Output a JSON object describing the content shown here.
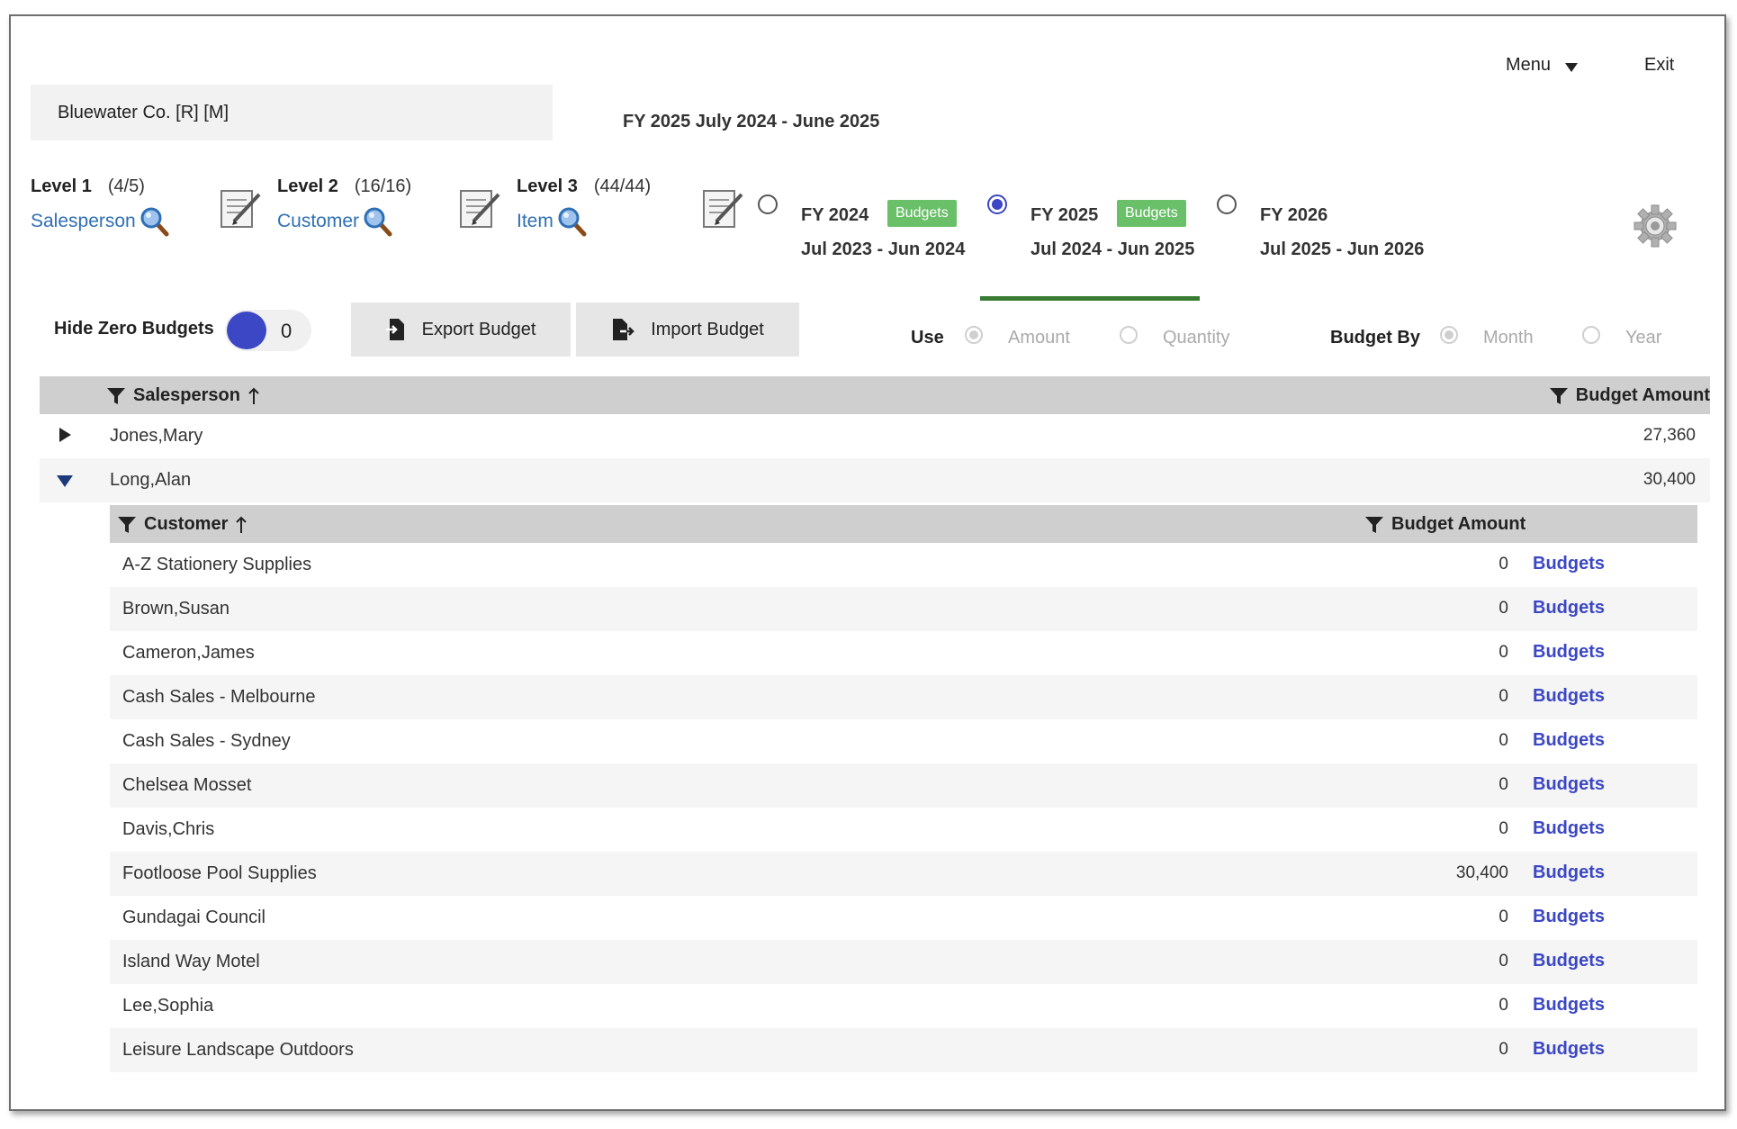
{
  "topnav": {
    "menu_label": "Menu",
    "exit_label": "Exit"
  },
  "company": {
    "name": "Bluewater Co. [R] [M]"
  },
  "fiscal_title": "FY 2025 July 2024 - June 2025",
  "levels": [
    {
      "title": "Level 1",
      "count": "(4/5)",
      "link": "Salesperson"
    },
    {
      "title": "Level 2",
      "count": "(16/16)",
      "link": "Customer"
    },
    {
      "title": "Level 3",
      "count": "(44/44)",
      "link": "Item"
    }
  ],
  "fiscal_years": [
    {
      "name": "FY 2024",
      "range": "Jul 2023 - Jun 2024",
      "badge": "Budgets",
      "selected": false
    },
    {
      "name": "FY 2025",
      "range": "Jul 2024 - Jun 2025",
      "badge": "Budgets",
      "selected": true
    },
    {
      "name": "FY 2026",
      "range": "Jul 2025 - Jun 2026",
      "badge": "",
      "selected": false
    }
  ],
  "controls": {
    "hide_zero_label": "Hide Zero Budgets",
    "hide_zero_value": "0",
    "export_label": "Export Budget",
    "import_label": "Import Budget",
    "use_label": "Use",
    "use_options": [
      "Amount",
      "Quantity"
    ],
    "use_selected": "Amount",
    "budget_by_label": "Budget By",
    "budget_by_options": [
      "Month",
      "Year"
    ],
    "budget_by_selected": "Month"
  },
  "table": {
    "col_salesperson": "Salesperson",
    "col_amount": "Budget Amount",
    "rows": [
      {
        "name": "Jones,Mary",
        "amount": "27,360",
        "expanded": false
      },
      {
        "name": "Long,Alan",
        "amount": "30,400",
        "expanded": true
      }
    ]
  },
  "subtable": {
    "col_customer": "Customer",
    "col_amount": "Budget Amount",
    "link_label": "Budgets",
    "rows": [
      {
        "name": "A-Z Stationery Supplies",
        "amount": "0"
      },
      {
        "name": "Brown,Susan",
        "amount": "0"
      },
      {
        "name": "Cameron,James",
        "amount": "0"
      },
      {
        "name": "Cash Sales - Melbourne",
        "amount": "0"
      },
      {
        "name": "Cash Sales - Sydney",
        "amount": "0"
      },
      {
        "name": "Chelsea Mosset",
        "amount": "0"
      },
      {
        "name": "Davis,Chris",
        "amount": "0"
      },
      {
        "name": "Footloose Pool Supplies",
        "amount": "30,400"
      },
      {
        "name": "Gundagai Council",
        "amount": "0"
      },
      {
        "name": "Island Way Motel",
        "amount": "0"
      },
      {
        "name": "Lee,Sophia",
        "amount": "0"
      },
      {
        "name": "Leisure Landscape Outdoors",
        "amount": "0"
      }
    ]
  },
  "colors": {
    "accent": "#3b47c4",
    "link": "#2f6fb5",
    "badge": "#6abf69",
    "underline": "#3a7b33",
    "header_bg": "#cfcfcf"
  },
  "icons": [
    "caret-down-icon",
    "document-edit-icon",
    "magnifier-icon",
    "gear-icon",
    "funnel-icon",
    "sort-up-icon",
    "export-icon",
    "import-icon",
    "expand-icon",
    "collapse-icon"
  ]
}
